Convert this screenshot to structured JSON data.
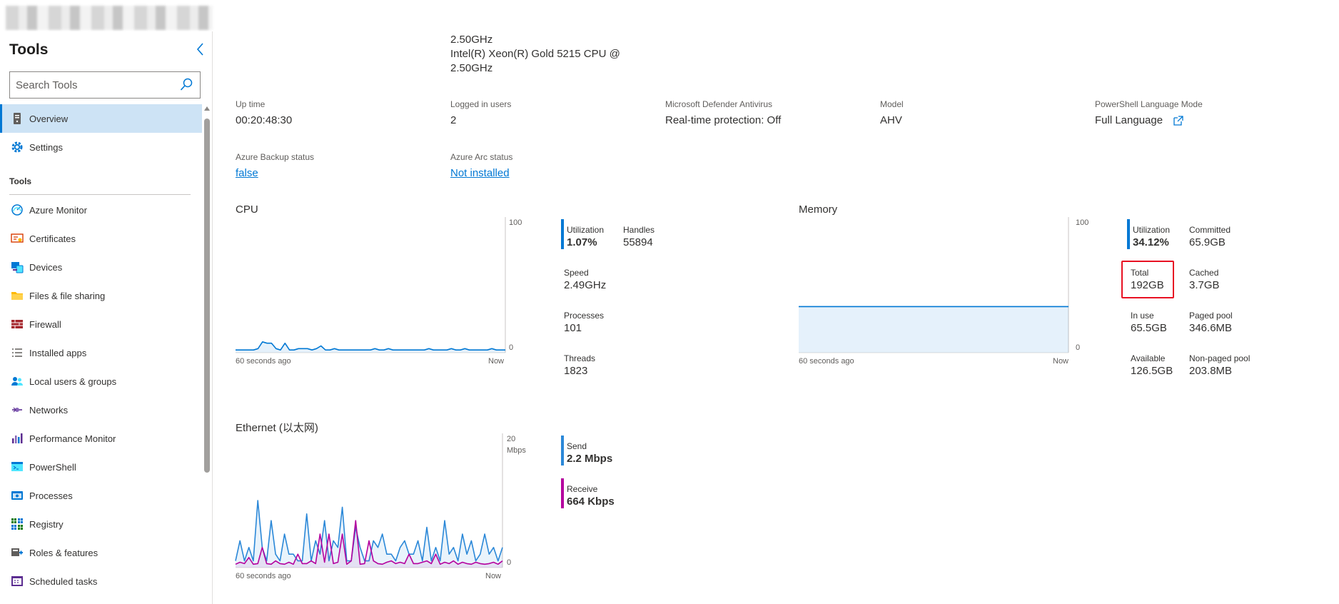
{
  "sidebar": {
    "title": "Tools",
    "search_placeholder": "Search Tools",
    "top_items": [
      {
        "label": "Overview",
        "icon": "server-icon"
      },
      {
        "label": "Settings",
        "icon": "gear-icon"
      }
    ],
    "section_header": "Tools",
    "items": [
      {
        "label": "Azure Monitor",
        "icon": "azure-monitor-icon"
      },
      {
        "label": "Certificates",
        "icon": "certificate-icon"
      },
      {
        "label": "Devices",
        "icon": "devices-icon"
      },
      {
        "label": "Files & file sharing",
        "icon": "folder-icon"
      },
      {
        "label": "Firewall",
        "icon": "firewall-icon"
      },
      {
        "label": "Installed apps",
        "icon": "list-icon"
      },
      {
        "label": "Local users & groups",
        "icon": "users-icon"
      },
      {
        "label": "Networks",
        "icon": "network-icon"
      },
      {
        "label": "Performance Monitor",
        "icon": "performance-icon"
      },
      {
        "label": "PowerShell",
        "icon": "powershell-icon"
      },
      {
        "label": "Processes",
        "icon": "processes-icon"
      },
      {
        "label": "Registry",
        "icon": "registry-icon"
      },
      {
        "label": "Roles & features",
        "icon": "roles-icon"
      },
      {
        "label": "Scheduled tasks",
        "icon": "scheduled-tasks-icon"
      }
    ]
  },
  "system": {
    "processor_line1": "2.50GHz",
    "processor_line2": "Intel(R) Xeon(R) Gold 5215 CPU @",
    "processor_line3": "2.50GHz",
    "up_time_label": "Up time",
    "up_time": "00:20:48:30",
    "logged_users_label": "Logged in users",
    "logged_users": "2",
    "defender_label": "Microsoft Defender Antivirus",
    "defender": "Real-time protection: Off",
    "model_label": "Model",
    "model": "AHV",
    "ps_mode_label": "PowerShell Language Mode",
    "ps_mode": "Full Language",
    "backup_label": "Azure Backup status",
    "backup": "false",
    "arc_label": "Azure Arc status",
    "arc": "Not installed"
  },
  "cpu": {
    "title": "CPU",
    "y_max_label": "100",
    "y_min_label": "0",
    "x_left_label": "60 seconds ago",
    "x_right_label": "Now",
    "stats": {
      "utilization_label": "Utilization",
      "utilization": "1.07%",
      "handles_label": "Handles",
      "handles": "55894",
      "speed_label": "Speed",
      "speed": "2.49GHz",
      "processes_label": "Processes",
      "processes": "101",
      "threads_label": "Threads",
      "threads": "1823"
    }
  },
  "memory": {
    "title": "Memory",
    "y_max_label": "100",
    "y_min_label": "0",
    "x_left_label": "60 seconds ago",
    "x_right_label": "Now",
    "stats": {
      "utilization_label": "Utilization",
      "utilization": "34.12%",
      "committed_label": "Committed",
      "committed": "65.9GB",
      "total_label": "Total",
      "total": "192GB",
      "cached_label": "Cached",
      "cached": "3.7GB",
      "in_use_label": "In use",
      "in_use": "65.5GB",
      "paged_pool_label": "Paged pool",
      "paged_pool": "346.6MB",
      "available_label": "Available",
      "available": "126.5GB",
      "non_paged_pool_label": "Non-paged pool",
      "non_paged_pool": "203.8MB"
    }
  },
  "ethernet": {
    "title": "Ethernet (以太网)",
    "y_max_label": "20",
    "y_unit_label": "Mbps",
    "y_min_label": "0",
    "x_left_label": "60 seconds ago",
    "x_right_label": "Now",
    "stats": {
      "send_label": "Send",
      "send": "2.2 Mbps",
      "receive_label": "Receive",
      "receive": "664 Kbps"
    }
  },
  "colors": {
    "accent": "#0078d4",
    "send": "#2b88d8",
    "receive": "#b4009e",
    "highlight": "#e81123"
  },
  "chart_data": [
    {
      "type": "area",
      "ylim": [
        0,
        100
      ],
      "series": [
        {
          "values": [
            2,
            2,
            2,
            2,
            2,
            3,
            8,
            7,
            7,
            3,
            2,
            7,
            2,
            2,
            3,
            3,
            3,
            2,
            3,
            5,
            2,
            2,
            3,
            2,
            2,
            2,
            2,
            2,
            2,
            2,
            2,
            3,
            2,
            2,
            3,
            2,
            2,
            2,
            2,
            2,
            2,
            2,
            2,
            3,
            2,
            2,
            2,
            2,
            3,
            2,
            2,
            3,
            2,
            2,
            2,
            2,
            2,
            3,
            2,
            2,
            2
          ]
        }
      ]
    },
    {
      "type": "area",
      "ylim": [
        0,
        100
      ],
      "series": [
        {
          "values": [
            34,
            34,
            34,
            34,
            34,
            34,
            34,
            34,
            34,
            34,
            34,
            34,
            34,
            34,
            34,
            34,
            34,
            34,
            34,
            34,
            34,
            34,
            34,
            34,
            34,
            34,
            34,
            34,
            34,
            34,
            34,
            34,
            34,
            34,
            34,
            34,
            34,
            34,
            34,
            34,
            34,
            34,
            34,
            34,
            34,
            34,
            34,
            34,
            34,
            34,
            34,
            34,
            34,
            34,
            34,
            34,
            34,
            34,
            34,
            34,
            34
          ]
        }
      ]
    },
    {
      "type": "line",
      "ylim": [
        0,
        20
      ],
      "series": [
        {
          "name": "Send",
          "values": [
            1,
            4,
            1,
            3,
            1,
            10,
            3,
            1,
            7,
            2,
            1,
            5,
            2,
            2,
            1,
            1,
            8,
            1,
            4,
            2,
            7,
            1,
            4,
            3,
            9,
            1,
            1,
            6,
            3,
            1,
            1,
            4,
            3,
            5,
            2,
            2,
            1,
            3,
            4,
            2,
            2,
            4,
            1,
            6,
            1,
            3,
            1,
            7,
            2,
            3,
            1,
            5,
            2,
            4,
            1,
            2,
            5,
            2,
            3,
            1,
            3
          ]
        },
        {
          "name": "Receive",
          "values": [
            0.5,
            0.8,
            0.6,
            1.5,
            0.5,
            0.6,
            3,
            0.6,
            0.5,
            1,
            0.6,
            0.5,
            0.8,
            0.5,
            2,
            0.6,
            0.6,
            1,
            0.6,
            5,
            0.8,
            5,
            0.6,
            0.8,
            5,
            0.5,
            1,
            7,
            0.5,
            0.6,
            4,
            1,
            0.6,
            0.5,
            0.8,
            1,
            0.6,
            0.8,
            0.6,
            2,
            0.6,
            0.6,
            0.8,
            1,
            0.6,
            2,
            0.5,
            0.8,
            0.6,
            1,
            0.5,
            0.8,
            0.6,
            0.5,
            0.8,
            0.6,
            0.5,
            0.6,
            0.8,
            0.5,
            1
          ]
        }
      ]
    }
  ]
}
